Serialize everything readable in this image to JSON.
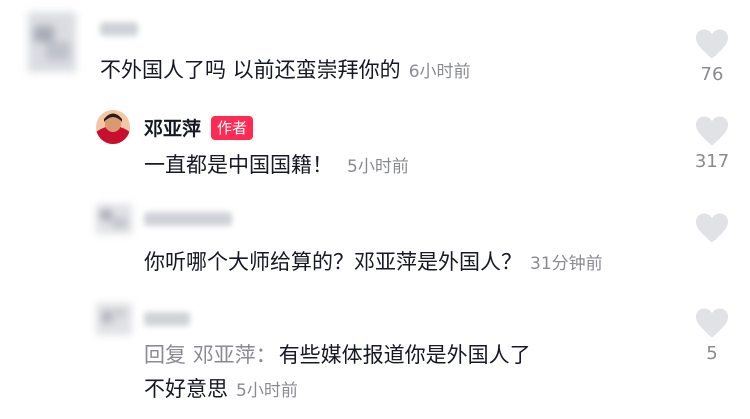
{
  "comments": [
    {
      "text": "不外国人了吗 以前还蛮崇拜你的",
      "time": "6小时前",
      "likes": "76"
    },
    {
      "author": "邓亚萍",
      "badge": "作者",
      "text": "一直都是中国国籍！",
      "time": "5小时前",
      "likes": "317"
    },
    {
      "text": "你听哪个大师给算的？邓亚萍是外国人？",
      "time": "31分钟前",
      "likes": ""
    },
    {
      "reply_prefix": "回复",
      "reply_to": "邓亚萍：",
      "text_line1": "有些媒体报道你是外国人了",
      "text_line2": "不好意思",
      "time": "5小时前",
      "likes": "5"
    }
  ]
}
